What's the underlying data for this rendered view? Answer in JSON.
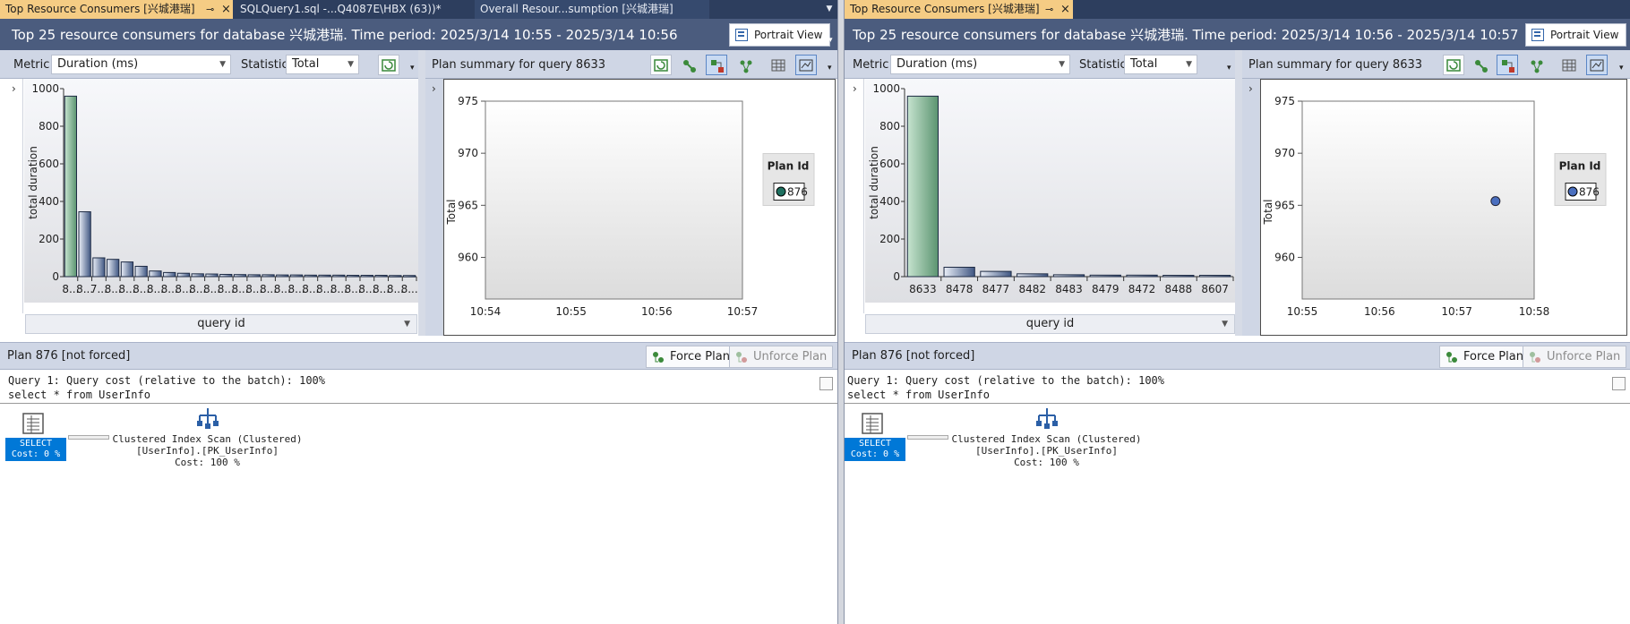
{
  "colors": {
    "tabstrip": "#2d3e5e",
    "title_bar": "#4b5c7e",
    "active_tab": "#f5cc84",
    "toolbar": "#cfd6e5",
    "select_badge": "#0078d7"
  },
  "left": {
    "tabs": [
      {
        "label": "Top Resource Consumers [兴城港瑞]",
        "pin": "⊸",
        "close": "×"
      },
      {
        "label": "SQLQuery1.sql -...Q4087E\\HBX (63))*"
      },
      {
        "label": "Overall Resour...sumption [兴城港瑞]"
      }
    ],
    "title": "Top 25 resource consumers for database 兴城港瑞. Time period: 2025/3/14 10:55 - 2025/3/14 10:56",
    "portrait_view": "Portrait View",
    "metric_label": "Metric",
    "metric_value": "Duration (ms)",
    "statistic_label": "Statistic",
    "statistic_value": "Total",
    "plan_summary": "Plan summary for query 8633",
    "query_id_label": "query id",
    "plan_label": "Plan 876 [not forced]",
    "force_plan": "Force Plan",
    "unforce_plan": "Unforce Plan",
    "query_line1": "Query 1: Query cost (relative to the batch): 100%",
    "query_line2": "select * from UserInfo",
    "op_select": "SELECT",
    "op_select_cost": "Cost: 0 %",
    "op_scan_1": "Clustered Index Scan (Clustered)",
    "op_scan_2": "[UserInfo].[PK_UserInfo]",
    "op_scan_3": "Cost: 100 %"
  },
  "right": {
    "tabs": [
      {
        "label": "Top Resource Consumers [兴城港瑞]",
        "pin": "⊸",
        "close": "×"
      }
    ],
    "title": "Top 25 resource consumers for database 兴城港瑞. Time period: 2025/3/14 10:56 - 2025/3/14 10:57",
    "portrait_view": "Portrait View",
    "metric_label": "Metric",
    "metric_value": "Duration (ms)",
    "statistic_label": "Statistic",
    "statistic_value": "Total",
    "plan_summary": "Plan summary for query 8633",
    "query_id_label": "query id",
    "plan_label": "Plan 876 [not forced]",
    "force_plan": "Force Plan",
    "unforce_plan": "Unforce Plan",
    "query_line1": "Query 1: Query cost (relative to the batch): 100%",
    "query_line2": "select * from UserInfo",
    "op_select": "SELECT",
    "op_select_cost": "Cost: 0 %",
    "op_scan_1": "Clustered Index Scan (Clustered)",
    "op_scan_2": "[UserInfo].[PK_UserInfo]",
    "op_scan_3": "Cost: 100 %"
  },
  "chart_data": [
    {
      "type": "bar",
      "ylabel": "total duration",
      "xlabel": "query id",
      "ylim": [
        0,
        1000
      ],
      "yticks": [
        0,
        200,
        400,
        600,
        800,
        1000
      ],
      "categories": [
        "8...",
        "8...",
        "7...",
        "8...",
        "8...",
        "8...",
        "8...",
        "8...",
        "8...",
        "8...",
        "8...",
        "8...",
        "8...",
        "8...",
        "8...",
        "8...",
        "8...",
        "8...",
        "8...",
        "8...",
        "8...",
        "8...",
        "8...",
        "8...",
        "8..."
      ],
      "values": [
        960,
        345,
        100,
        92,
        78,
        55,
        30,
        22,
        18,
        15,
        14,
        12,
        11,
        10,
        10,
        9,
        9,
        8,
        8,
        8,
        7,
        7,
        7,
        6,
        6
      ],
      "highlight_index": 0
    },
    {
      "type": "scatter",
      "ylabel": "Total",
      "yticks": [
        960,
        965,
        970,
        975
      ],
      "ylim": [
        956,
        975
      ],
      "xticks": [
        "10:54",
        "10:55",
        "10:56",
        "10:57"
      ],
      "legend_title": "Plan Id",
      "series": [
        {
          "name": "876",
          "color": "#1e7060",
          "points": []
        }
      ]
    },
    {
      "type": "bar",
      "ylabel": "total duration",
      "xlabel": "query id",
      "ylim": [
        0,
        1000
      ],
      "yticks": [
        0,
        200,
        400,
        600,
        800,
        1000
      ],
      "categories": [
        "8633",
        "8478",
        "8477",
        "8482",
        "8483",
        "8479",
        "8472",
        "8488",
        "8607"
      ],
      "values": [
        960,
        50,
        28,
        15,
        10,
        8,
        8,
        7,
        7
      ],
      "highlight_index": 0
    },
    {
      "type": "scatter",
      "ylabel": "Total",
      "yticks": [
        960,
        965,
        970,
        975
      ],
      "ylim": [
        956,
        975
      ],
      "xticks": [
        "10:55",
        "10:56",
        "10:57",
        "10:58"
      ],
      "legend_title": "Plan Id",
      "series": [
        {
          "name": "876",
          "color": "#4a6fbf",
          "points": [
            {
              "x": "10:57:30",
              "y": 965.4
            }
          ]
        }
      ]
    }
  ]
}
